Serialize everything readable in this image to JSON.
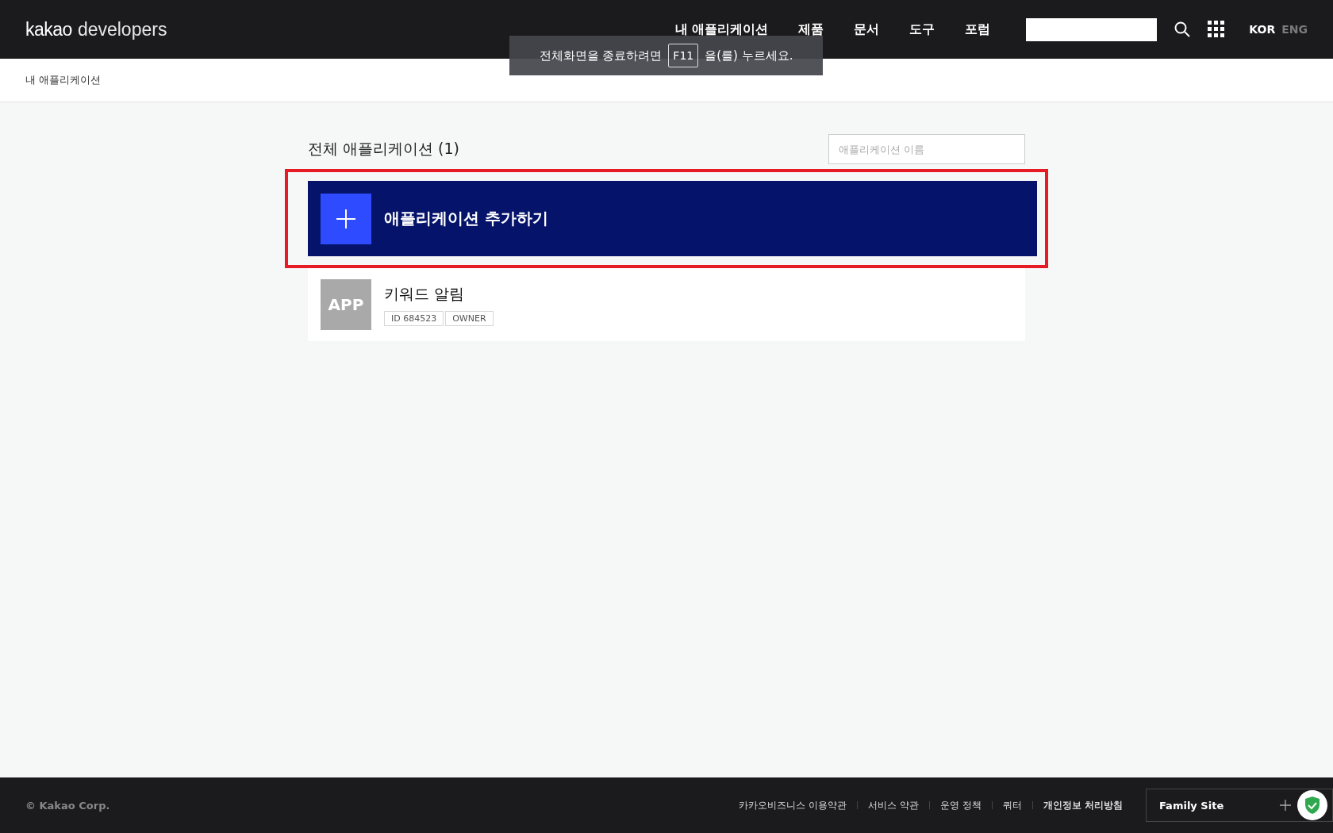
{
  "header": {
    "logo": {
      "brand": "kakao",
      "product": "developers"
    },
    "nav": [
      {
        "label": "내 애플리케이션"
      },
      {
        "label": "제품"
      },
      {
        "label": "문서"
      },
      {
        "label": "도구"
      },
      {
        "label": "포럼"
      }
    ],
    "languages": [
      {
        "label": "KOR",
        "selected": true
      },
      {
        "label": "ENG",
        "selected": false
      }
    ]
  },
  "fullscreen_notice": {
    "before": "전체화면을 종료하려면",
    "key": "F11",
    "after": "을(를) 누르세요."
  },
  "breadcrumb": "내 애플리케이션",
  "apps": {
    "title": "전체 애플리케이션 (1)",
    "search": {
      "placeholder": "애플리케이션 이름"
    },
    "add_button": {
      "label": "애플리케이션 추가하기",
      "highlighted": true
    },
    "items": [
      {
        "icon_text": "APP",
        "name": "키워드 알림",
        "tags": [
          "ID 684523",
          "OWNER"
        ]
      }
    ]
  },
  "footer": {
    "copyright": "© Kakao Corp.",
    "links": [
      {
        "label": "카카오비즈니스 이용약관",
        "emphasized": false
      },
      {
        "label": "서비스 약관",
        "emphasized": false
      },
      {
        "label": "운영 정책",
        "emphasized": false
      },
      {
        "label": "쿼터",
        "emphasized": false
      },
      {
        "label": "개인정보 처리방침",
        "emphasized": true
      }
    ],
    "family_site": "Family Site"
  }
}
